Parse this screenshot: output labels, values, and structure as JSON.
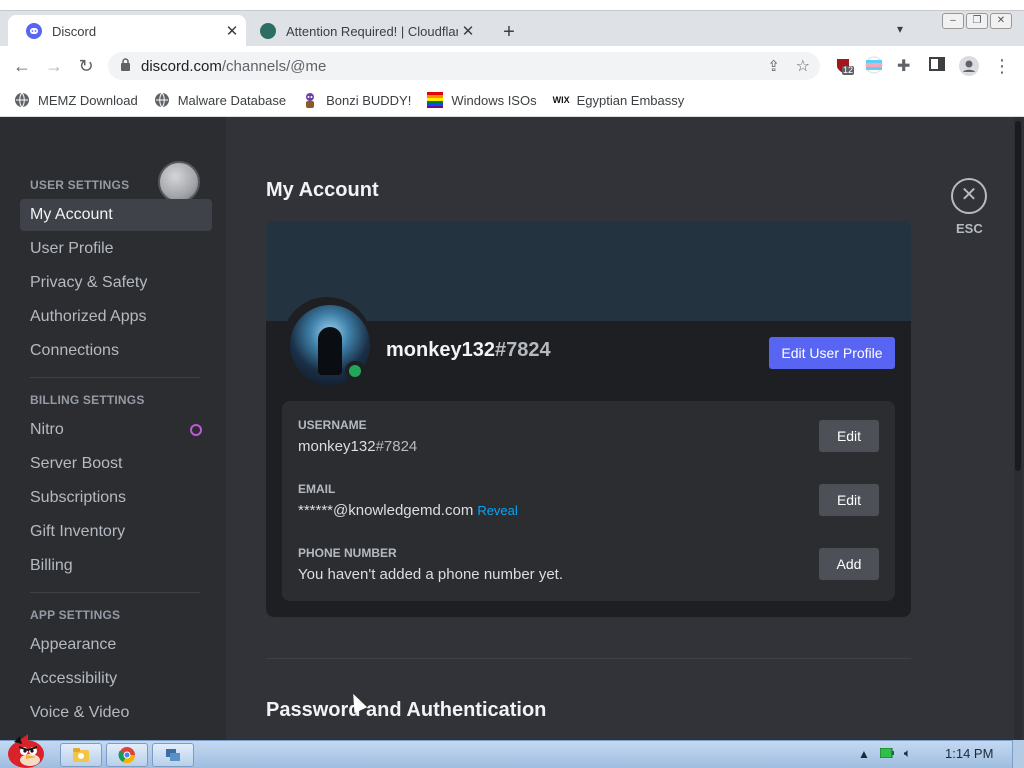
{
  "browser": {
    "tabs": [
      {
        "title": "Discord",
        "active": true
      },
      {
        "title": "Attention Required! | Cloudflar",
        "active": false
      }
    ],
    "new_tab_label": "+",
    "url_host": "discord.com",
    "url_path": "/channels/@me",
    "extension_badge": "12",
    "bookmarks": [
      {
        "label": "MEMZ Download",
        "icon": "globe-icon"
      },
      {
        "label": "Malware Database",
        "icon": "globe-icon"
      },
      {
        "label": "Bonzi BUDDY!",
        "icon": "bonzi-icon"
      },
      {
        "label": "Windows ISOs",
        "icon": "rainbow-flag-icon"
      },
      {
        "label": "Egyptian Embassy",
        "icon": "wix-icon"
      }
    ],
    "bookmark_wix": "WIX"
  },
  "sidebar": {
    "user_settings_header": "USER SETTINGS",
    "user_items": [
      "My Account",
      "User Profile",
      "Privacy & Safety",
      "Authorized Apps",
      "Connections"
    ],
    "billing_header": "BILLING SETTINGS",
    "billing_items": [
      "Nitro",
      "Server Boost",
      "Subscriptions",
      "Gift Inventory",
      "Billing"
    ],
    "app_header": "APP SETTINGS",
    "app_items": [
      "Appearance",
      "Accessibility",
      "Voice & Video"
    ]
  },
  "main": {
    "title": "My Account",
    "esc_label": "ESC",
    "close_symbol": "✕",
    "username": "monkey132",
    "discriminator": "#7824",
    "edit_profile_label": "Edit User Profile",
    "fields": {
      "username_label": "USERNAME",
      "username_value": "monkey132",
      "username_tag": "#7824",
      "username_btn": "Edit",
      "email_label": "EMAIL",
      "email_value": "******@knowledgemd.com",
      "email_reveal": "Reveal",
      "email_btn": "Edit",
      "phone_label": "PHONE NUMBER",
      "phone_value": "You haven't added a phone number yet.",
      "phone_btn": "Add"
    },
    "password_title": "Password and Authentication"
  },
  "taskbar": {
    "clock": "1:14 PM"
  },
  "colors": {
    "blurple": "#5865f2",
    "online": "#23a55a",
    "link": "#00a8fc",
    "nitro": "#c157d9"
  }
}
